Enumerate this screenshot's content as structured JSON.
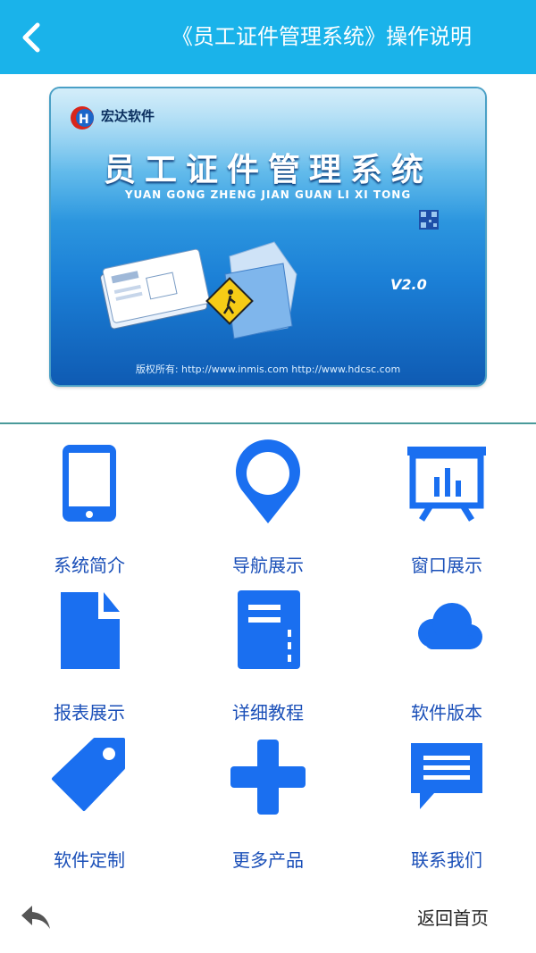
{
  "header": {
    "title": "《员工证件管理系统》操作说明",
    "back_icon": "chevron-left-icon",
    "bg_color": "#1ab3ea"
  },
  "banner": {
    "company": "宏达软件",
    "main_title": "员工证件管理系统",
    "pinyin": "YUAN GONG ZHENG JIAN GUAN LI XI TONG",
    "version": "V2.0",
    "copyright": "版权所有: http://www.inmis.com http://www.hdcsc.com"
  },
  "menu": {
    "accent_color": "#1a6ff0",
    "items": [
      {
        "label": "系统简介",
        "icon": "smartphone-icon"
      },
      {
        "label": "导航展示",
        "icon": "map-pin-icon"
      },
      {
        "label": "窗口展示",
        "icon": "presentation-chart-icon"
      },
      {
        "label": "报表展示",
        "icon": "document-icon"
      },
      {
        "label": "详细教程",
        "icon": "notebook-icon"
      },
      {
        "label": "软件版本",
        "icon": "cloud-icon"
      },
      {
        "label": "软件定制",
        "icon": "tag-icon"
      },
      {
        "label": "更多产品",
        "icon": "plus-icon"
      },
      {
        "label": "联系我们",
        "icon": "message-icon"
      }
    ]
  },
  "footer": {
    "back_icon": "reply-arrow-icon",
    "home_label": "返回首页"
  }
}
